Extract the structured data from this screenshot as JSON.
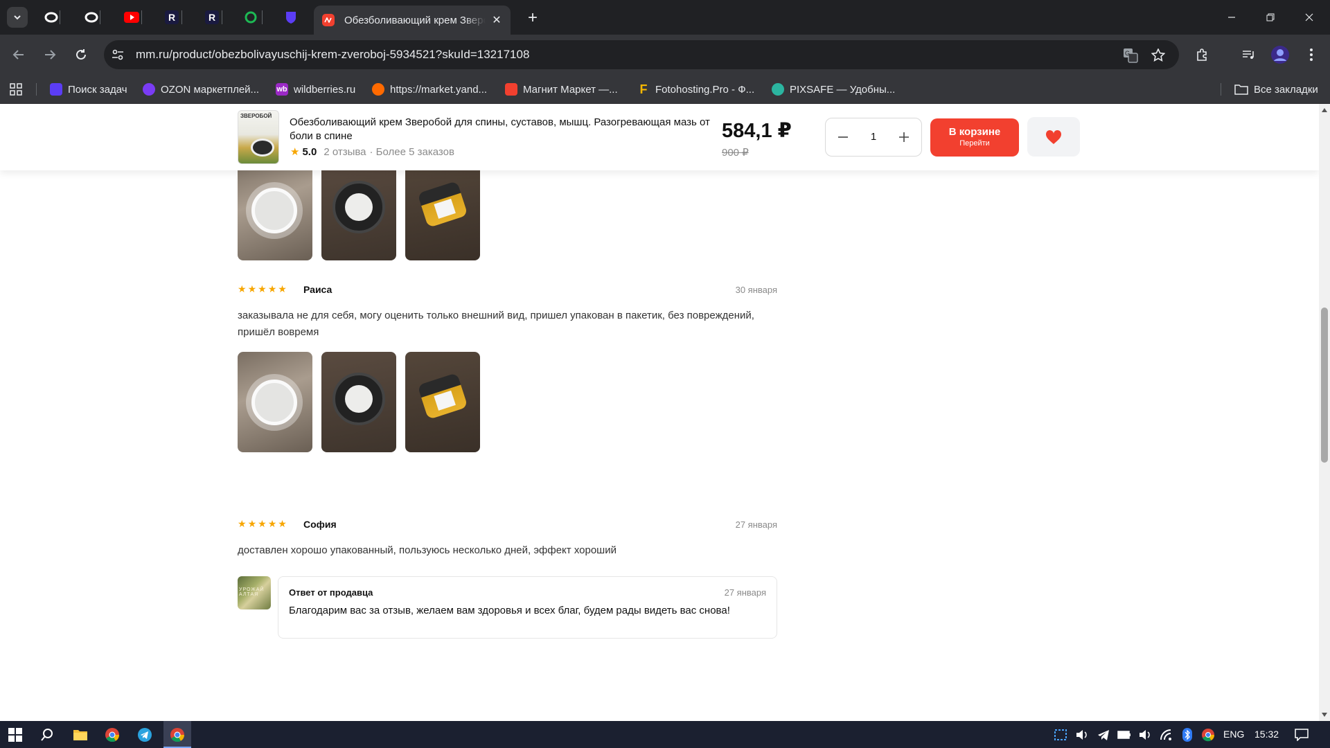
{
  "browser": {
    "active_tab_title": "Обезболивающий крем Зверобой для спины, суставов, мышц",
    "url": "mm.ru/product/obezbolivayuschij-krem-zveroboj-5934521?skuId=13217108",
    "bookmarks": [
      {
        "label": "Поиск задач",
        "icon": "purple-shield-icon",
        "color": "#5b3df5"
      },
      {
        "label": "OZON маркетплей...",
        "icon": "ozon-icon",
        "color": "#7a3cf5"
      },
      {
        "label": "wildberries.ru",
        "icon": "wb-icon",
        "color": "#9b29c6"
      },
      {
        "label": "https://market.yand...",
        "icon": "yandex-market-icon",
        "color": "#ff6a00"
      },
      {
        "label": "Магнит Маркет —...",
        "icon": "magnit-icon",
        "color": "#f2402f"
      },
      {
        "label": "Fotohosting.Pro - Ф...",
        "icon": "letter-f-icon",
        "color": "#f5b700"
      },
      {
        "label": "PIXSAFE — Удобны...",
        "icon": "pixsafe-icon",
        "color": "#2bb5a0"
      }
    ],
    "all_bookmarks_label": "Все закладки",
    "new_tab_symbol": "+",
    "close_symbol": "✕"
  },
  "product_bar": {
    "thumb_label": "ЗВЕРОБОЙ",
    "title": "Обезболивающий крем Зверобой для спины, суставов, мышц. Разогревающая мазь от боли в спине",
    "rating": "5.0",
    "reviews": "2 отзыва",
    "orders": "· Более 5 заказов",
    "price": "584,1 ₽",
    "old_price": "900 ₽",
    "quantity": "1",
    "cart_label": "В корзине",
    "cart_sublabel": "Перейти",
    "accent_color": "#f2402f"
  },
  "reviews": [
    {
      "author": "Раиса",
      "date": "30 января",
      "stars": 5,
      "text": "заказывала не для себя, могу оценить только внешний вид, пришел упакован в пакетик, без повреждений, пришёл вовремя"
    },
    {
      "author": "София",
      "date": "27 января",
      "stars": 5,
      "text": "доставлен хорошо упакованный, пользуюсь несколько дней, эффект хороший",
      "seller_reply": {
        "avatar_text": "УРОЖАЙ АЛТАЯ",
        "title": "Ответ от продавца",
        "date": "27 января",
        "text": "Благодарим вас за отзыв, желаем вам здоровья и всех благ, будем рады видеть вас снова!"
      }
    }
  ],
  "taskbar": {
    "language": "ENG",
    "time": "15:32"
  }
}
